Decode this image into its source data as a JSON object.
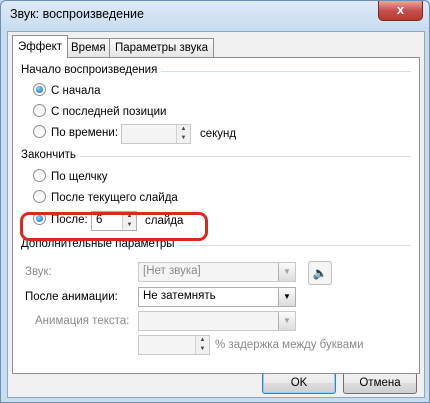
{
  "window": {
    "title": "Звук: воспроизведение",
    "close_glyph": "x"
  },
  "tabs": [
    {
      "label": "Эффект",
      "active": true
    },
    {
      "label": "Время",
      "active": false
    },
    {
      "label": "Параметры звука",
      "active": false
    }
  ],
  "start_group": {
    "title": "Начало воспроизведения",
    "options": [
      {
        "label": "С начала",
        "checked": true
      },
      {
        "label": "С последней позиции",
        "checked": false
      },
      {
        "label": "По времени:",
        "checked": false
      }
    ],
    "time_value": "",
    "time_unit": "секунд"
  },
  "end_group": {
    "title": "Закончить",
    "options": [
      {
        "label": "По щелчку",
        "checked": false
      },
      {
        "label": "После текущего слайда",
        "checked": false
      },
      {
        "label": "После:",
        "checked": true
      }
    ],
    "after_value": "6",
    "after_unit": "слайда"
  },
  "extra_group": {
    "title": "Дополнительные параметры",
    "sound_label": "Звук:",
    "sound_value": "[Нет звука]",
    "after_anim_label": "После анимации:",
    "after_anim_value": "Не затемнять",
    "text_anim_label": "Анимация текста:",
    "text_anim_value": "",
    "delay_value": "",
    "delay_label": "% задержка между буквами"
  },
  "buttons": {
    "ok": "OK",
    "cancel": "Отмена"
  },
  "colors": {
    "highlight": "#d9291c",
    "accent": "#1a63b8"
  }
}
